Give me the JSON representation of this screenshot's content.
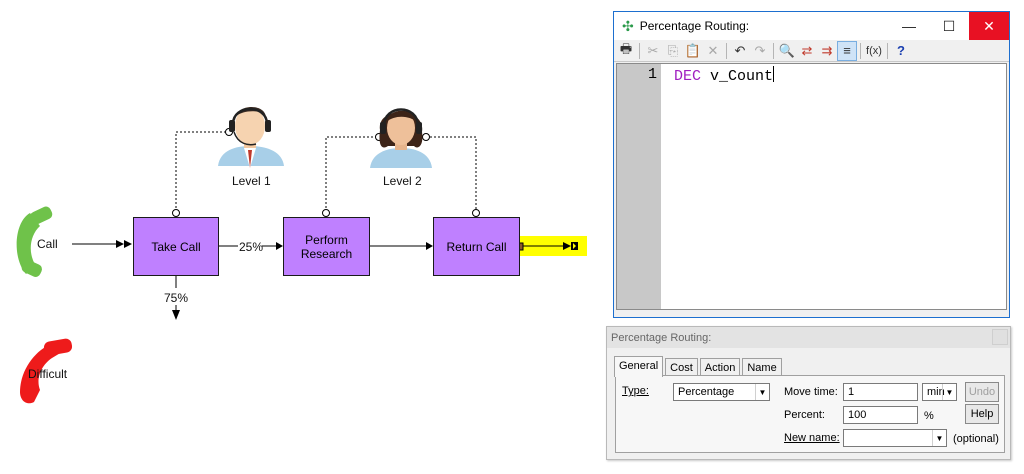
{
  "diagram": {
    "call_label": "Call",
    "difficult_label": "Difficult",
    "nodes": {
      "take_call": "Take Call",
      "perform_research_1": "Perform",
      "perform_research_2": "Research",
      "return_call": "Return Call"
    },
    "resources": {
      "level1": "Level 1",
      "level2": "Level 2"
    },
    "routing": {
      "to_research": "25%",
      "down": "75%"
    },
    "colors": {
      "activity_fill": "#bf80ff",
      "selected_highlight": "#ffff00",
      "phone_green": "#6fc24a",
      "phone_red": "#ee1b1b"
    }
  },
  "editor": {
    "title": "Percentage Routing:",
    "window_controls": {
      "minimize": "—",
      "maximize": "☐",
      "close": "✕"
    },
    "toolbar_icons": [
      "print-icon",
      "cut-icon",
      "copy-icon",
      "paste-icon",
      "delete-icon",
      "undo-icon",
      "redo-icon",
      "find-icon",
      "replace-icon",
      "goto-icon",
      "format-icon",
      "function-icon",
      "help-icon"
    ],
    "line_number": "1",
    "code": {
      "keyword": "DEC",
      "rest": " v_Count"
    }
  },
  "props": {
    "title": "Percentage Routing:",
    "tabs": [
      "General",
      "Cost",
      "Action",
      "Name"
    ],
    "type_label": "Type:",
    "type_value": "Percentage",
    "move_time_label": "Move time:",
    "move_time_value": "1",
    "unit_value": "min",
    "undo_label": "Undo",
    "percent_label": "Percent:",
    "percent_value": "100",
    "percent_sign": "%",
    "help_label": "Help",
    "new_name_label": "New name:",
    "new_name_value": "",
    "optional_label": "(optional)"
  }
}
